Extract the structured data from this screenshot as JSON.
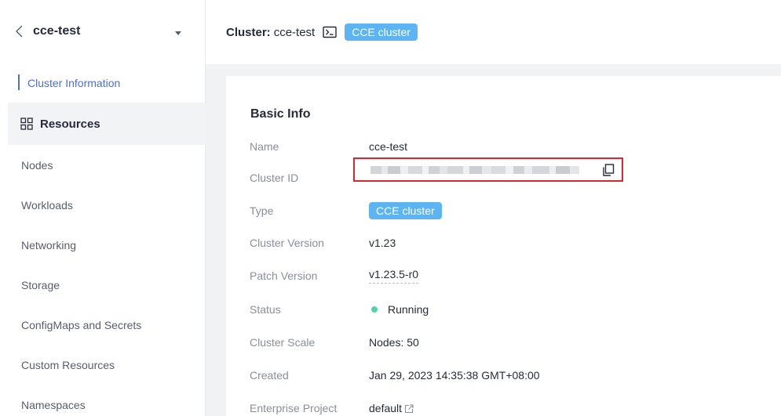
{
  "sidebar": {
    "cluster_name": "cce-test",
    "active_item": "Cluster Information",
    "group_label": "Resources",
    "items": [
      "Nodes",
      "Workloads",
      "Networking",
      "Storage",
      "ConfigMaps and Secrets",
      "Custom Resources",
      "Namespaces"
    ]
  },
  "header": {
    "label": "Cluster:",
    "cluster_name": "cce-test",
    "badge": "CCE cluster"
  },
  "basic_info": {
    "title": "Basic Info",
    "name_label": "Name",
    "name_value": "cce-test",
    "id_label": "Cluster ID",
    "type_label": "Type",
    "type_value": "CCE cluster",
    "version_label": "Cluster Version",
    "version_value": "v1.23",
    "patch_label": "Patch Version",
    "patch_value": "v1.23.5-r0",
    "status_label": "Status",
    "status_value": "Running",
    "scale_label": "Cluster Scale",
    "scale_value": "Nodes: 50",
    "created_label": "Created",
    "created_value": "Jan 29, 2023 14:35:38 GMT+08:00",
    "project_label": "Enterprise Project",
    "project_value": "default"
  },
  "colors": {
    "accent": "#526ecc",
    "badge": "#5cb4f2",
    "status_running": "#50d4ab",
    "highlight_border": "#d9272e"
  },
  "icons": {
    "back": "chevron-left-icon",
    "caret": "caret-down-icon",
    "resources": "grid-icon",
    "terminal": "terminal-icon",
    "copy": "copy-icon",
    "external": "external-link-icon"
  }
}
